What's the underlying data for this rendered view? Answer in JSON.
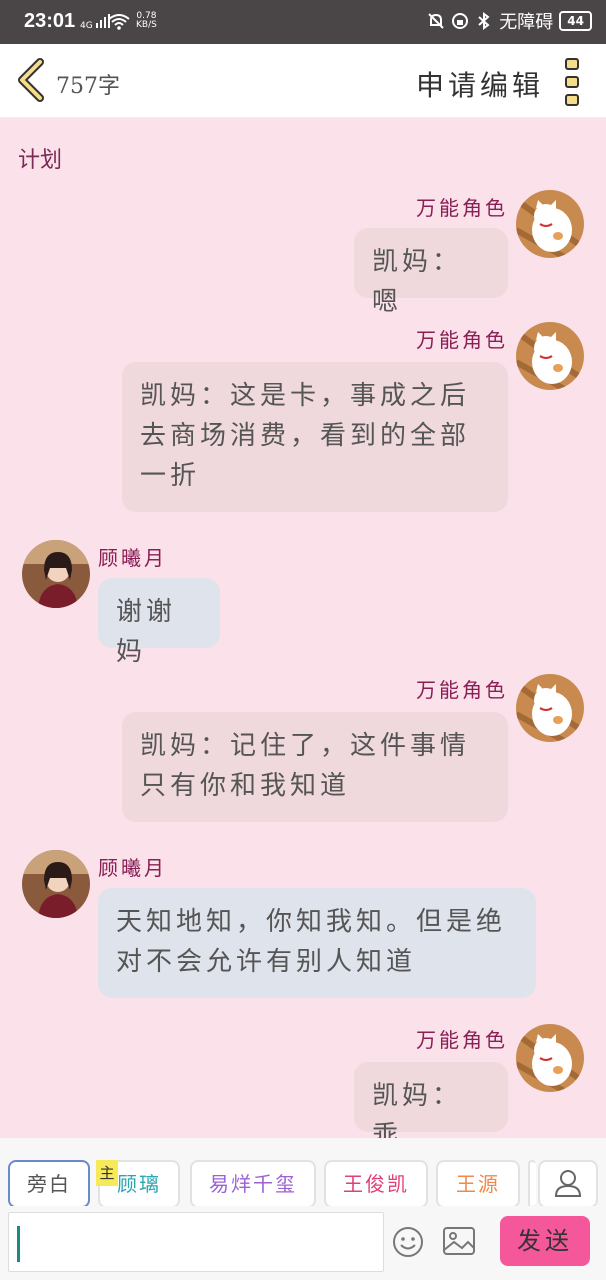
{
  "status_bar": {
    "time": "23:01",
    "network": "4G",
    "speed_value": "0.78",
    "speed_unit": "KB/S",
    "accessibility": "无障碍",
    "battery": "44"
  },
  "header": {
    "word_count": "757字",
    "apply_edit_label": "申请编辑",
    "back_icon": "chevron-left-icon",
    "more_icon": "more-vertical-icon"
  },
  "chat": {
    "section_label": "计划",
    "messages": [
      {
        "side": "right",
        "sender": "万能角色",
        "text": "凯妈：嗯"
      },
      {
        "side": "right",
        "sender": "万能角色",
        "text": "凯妈：这是卡，事成之后去商场消费，看到的全部一折"
      },
      {
        "side": "left",
        "sender": "顾曦月",
        "text": "谢谢妈"
      },
      {
        "side": "right",
        "sender": "万能角色",
        "text": "凯妈：记住了，这件事情只有你和我知道"
      },
      {
        "side": "left",
        "sender": "顾曦月",
        "text": "天知地知，你知我知。但是绝对不会允许有别人知道"
      },
      {
        "side": "right",
        "sender": "万能角色",
        "text": "凯妈：乖"
      }
    ]
  },
  "role_bar": {
    "main_badge": "主",
    "roles": [
      {
        "label": "旁白",
        "color": "#555555"
      },
      {
        "label": "顾璃",
        "color": "#2aa6b0"
      },
      {
        "label": "易烊千玺",
        "color": "#9b62d3"
      },
      {
        "label": "王俊凯",
        "color": "#e0407a"
      },
      {
        "label": "王源",
        "color": "#f0894a"
      }
    ],
    "contacts_icon": "user-icon"
  },
  "input_bar": {
    "placeholder": "",
    "send_label": "发送",
    "emoji_icon": "smiley-icon",
    "image_icon": "image-icon"
  }
}
